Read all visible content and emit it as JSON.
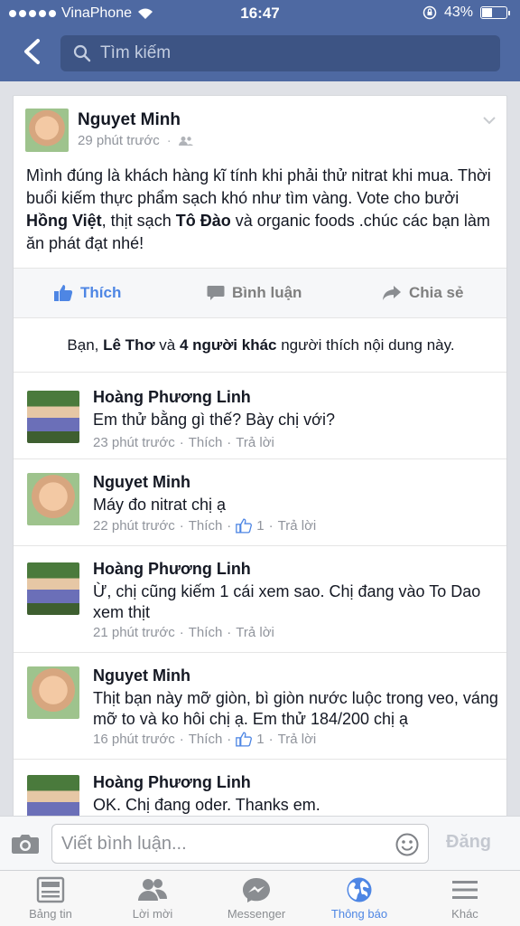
{
  "status_bar": {
    "carrier": "VinaPhone",
    "time": "16:47",
    "battery": "43%",
    "battery_level": 0.43
  },
  "search": {
    "placeholder": "Tìm kiếm"
  },
  "post": {
    "author": "Nguyet Minh",
    "time": "29 phút trước",
    "text_parts": {
      "p1": "Mình đúng là khách hàng kĩ tính khi phải thử nitrat khi mua. Thời buổi kiếm thực phẩm sạch khó như tìm vàng. Vote cho bưởi ",
      "b1": "Hồng Việt",
      "p2": ", thịt sạch ",
      "b2": "Tô Đào",
      "p3": " và organic foods .chúc các bạn làm ăn phát đạt nhé!"
    },
    "actions": {
      "like": "Thích",
      "comment": "Bình luận",
      "share": "Chia sẻ"
    },
    "likes": {
      "prefix": "Bạn, ",
      "name": "Lê Thơ",
      "mid": " và ",
      "others": "4 người khác",
      "suffix": " người thích nội dung này."
    }
  },
  "comments": [
    {
      "name": "Hoàng Phương Linh",
      "text": "Em thử bằng gì thế? Bày chị với?",
      "time": "23 phút trước",
      "like": "Thích",
      "reply": "Trả lời"
    },
    {
      "name": "Nguyet Minh",
      "text": "Máy đo nitrat chị ạ",
      "time": "22 phút trước",
      "like": "Thích",
      "likes": "1",
      "reply": "Trả lời"
    },
    {
      "name": "Hoàng Phương Linh",
      "text": "Ừ, chị cũng kiếm 1 cái xem sao. Chị đang vào To Dao xem thịt",
      "time": "21 phút trước",
      "like": "Thích",
      "reply": "Trả lời"
    },
    {
      "name": "Nguyet Minh",
      "text": "Thịt bạn này mỡ giòn, bì giòn nước luộc trong veo, váng mỡ to và ko hôi chị ạ. Em thử 184/200 chị ạ",
      "time": "16 phút trước",
      "like": "Thích",
      "likes": "1",
      "reply": "Trả lời"
    },
    {
      "name": "Hoàng Phương Linh",
      "text": "OK. Chị đang oder. Thanks em."
    }
  ],
  "composer": {
    "placeholder": "Viết bình luận...",
    "post_label": "Đăng"
  },
  "tabs": [
    {
      "label": "Bảng tin",
      "icon": "news-feed-icon"
    },
    {
      "label": "Lời mời",
      "icon": "friend-requests-icon"
    },
    {
      "label": "Messenger",
      "icon": "messenger-icon"
    },
    {
      "label": "Thông báo",
      "icon": "globe-icon"
    },
    {
      "label": "Khác",
      "icon": "menu-icon"
    }
  ],
  "colors": {
    "header": "#4e69a2",
    "accent": "#4e86e4"
  }
}
